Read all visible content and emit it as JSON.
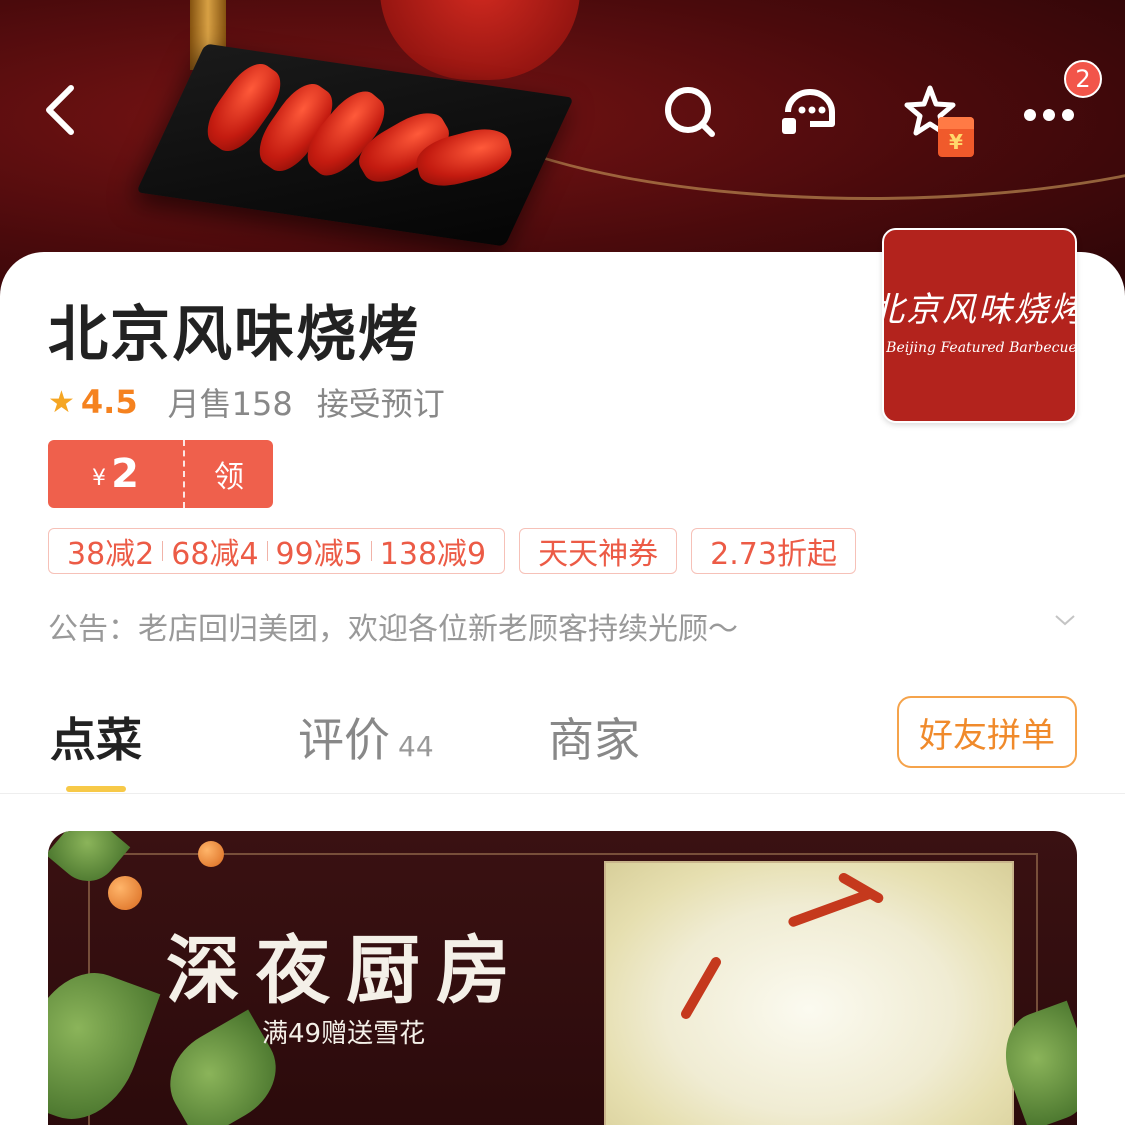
{
  "header": {
    "notification_count": "2",
    "redpacket_symbol": "¥"
  },
  "store": {
    "name": "北京风味烧烤",
    "logo_text_cn": "北京风味烧烤",
    "logo_text_en": "Beijing Featured Barbecue",
    "rating": "4.5",
    "monthly_sales": "月售158",
    "reservation": "接受预订"
  },
  "coupon": {
    "currency": "¥",
    "amount": "2",
    "action": "领"
  },
  "tags": {
    "discounts": [
      "38减2",
      "68减4",
      "99减5",
      "138减9"
    ],
    "daily_coupon": "天天神券",
    "discount_from": "2.73折起"
  },
  "notice": "公告：老店回归美团，欢迎各位新老顾客持续光顾～",
  "tabs": {
    "dishes": "点菜",
    "reviews": "评价",
    "reviews_count": "44",
    "merchant": "商家",
    "group_order": "好友拼单"
  },
  "promo": {
    "title": "深夜厨房",
    "subtitle": "满49赠送雪花"
  },
  "colors": {
    "accent_orange": "#f5821f",
    "coupon_red": "#ef604c",
    "tab_underline": "#f7c948"
  }
}
